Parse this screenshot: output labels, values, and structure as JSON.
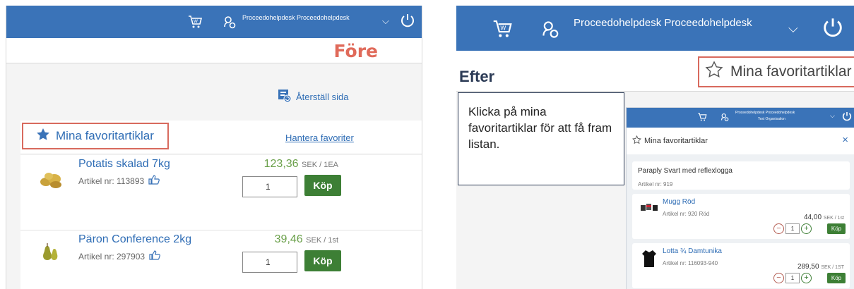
{
  "before": {
    "user_name": "Proceedohelpdesk Proceedohelpdesk",
    "label": "Före",
    "reset_label": "Återställ sida",
    "favorites_title": "Mina favoritartiklar",
    "manage_label": "Hantera favoriter",
    "products": [
      {
        "name": "Potatis skalad 7kg",
        "artnr": "Artikel nr: 113893",
        "price": "123,36",
        "unit": "SEK / 1EA",
        "qty": "1",
        "buy": "Köp"
      },
      {
        "name": "Päron Conference 2kg",
        "artnr": "Artikel nr: 297903",
        "price": "39,46",
        "unit": "SEK / 1st",
        "qty": "1",
        "buy": "Köp"
      }
    ]
  },
  "after": {
    "user_name": "Proceedohelpdesk Proceedohelpdesk",
    "label": "Efter",
    "favorites_button": "Mina favoritartiklar",
    "instruction": "Klicka på mina favoritartiklar för att få fram listan.",
    "inset": {
      "user_name": "Proceedohelpdesk Proceedohelpdesk",
      "org": "Test Organisation",
      "title": "Mina favoritartiklar",
      "close": "×",
      "plain_item": {
        "name": "Paraply Svart med reflexlogga",
        "artnr": "Artikel nr: 919"
      },
      "items": [
        {
          "name": "Mugg Röd",
          "artnr": "Artikel nr: 920 Röd",
          "price": "44,00",
          "unit": "SEK / 1st",
          "qty": "1",
          "buy": "Köp"
        },
        {
          "name": "Lotta ¾ Damtunika",
          "artnr": "Artikel nr: 116093-940",
          "price": "289,50",
          "unit": "SEK / 1ST",
          "qty": "1",
          "buy": "Köp"
        }
      ]
    }
  },
  "colors": {
    "brand_blue": "#3a73b8",
    "link_blue": "#2f6db5",
    "highlight_red": "#d86a5e",
    "buy_green": "#3d7f35"
  }
}
